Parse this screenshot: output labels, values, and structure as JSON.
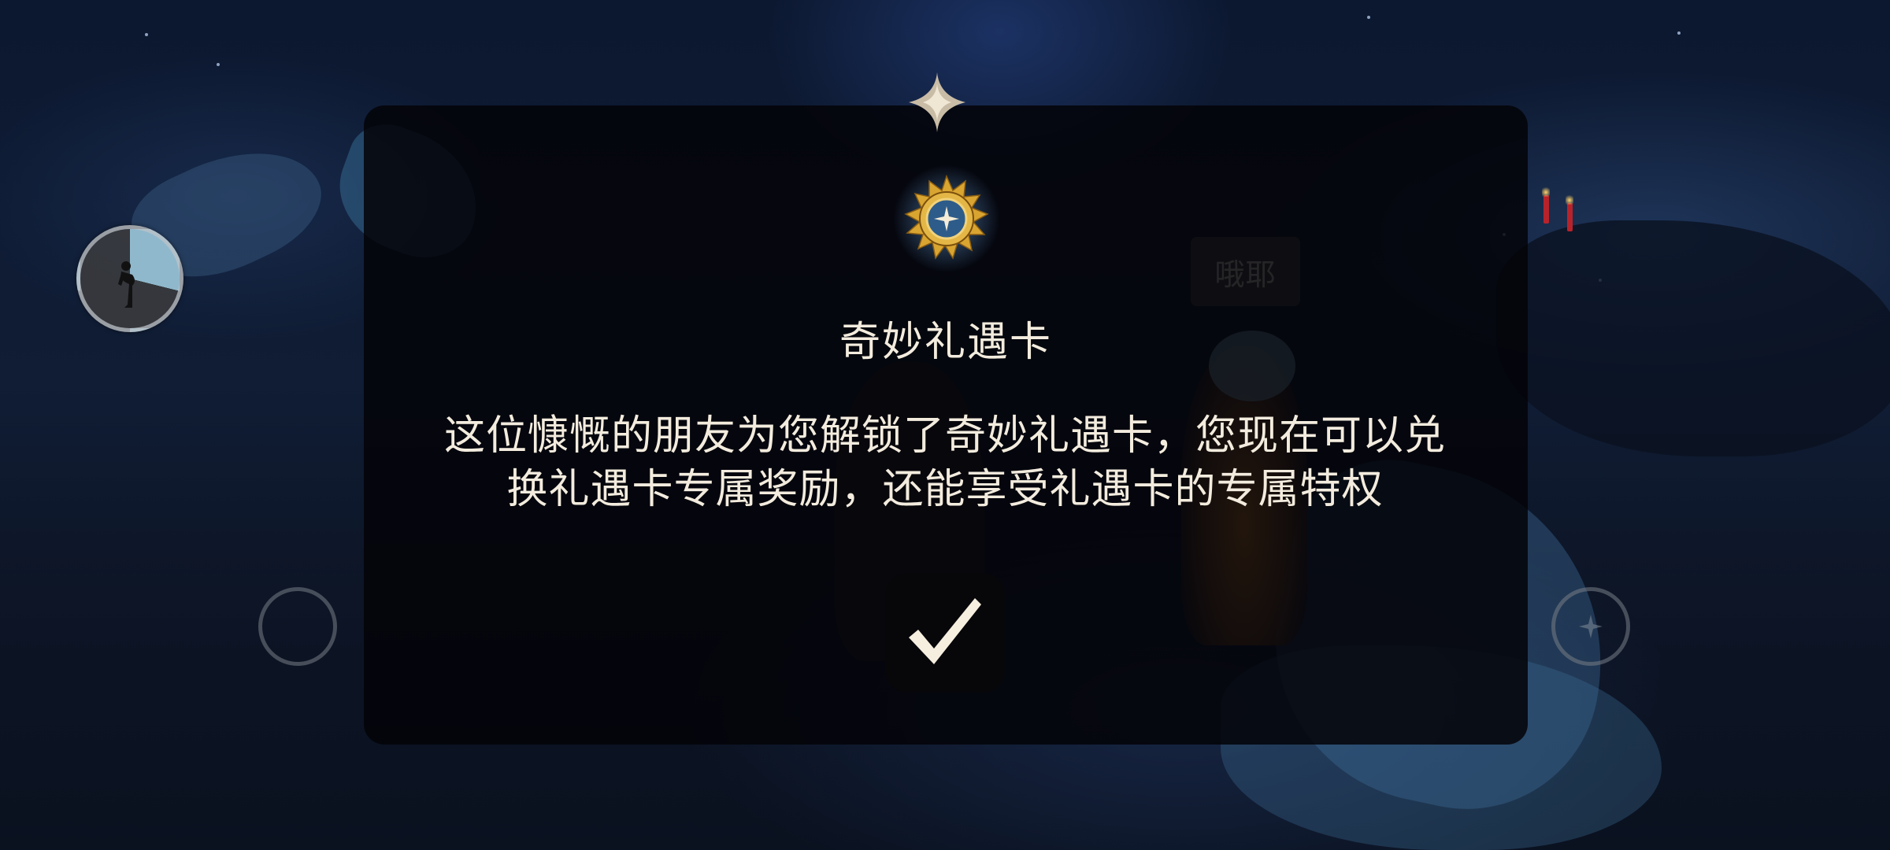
{
  "speech_bubble": {
    "text": "哦耶"
  },
  "dialog": {
    "title": "奇妙礼遇卡",
    "message_lines": [
      "这位慷慨的朋友为您解锁了奇妙礼遇卡，您现在可以兑",
      "换礼遇卡专属奖励，还能享受礼遇卡的专属特权"
    ],
    "icons": {
      "sparkle": "four-point-sparkle",
      "emblem": "golden-sun-card-emblem",
      "confirm": "checkmark"
    }
  },
  "hud": {
    "emote_button": {
      "icon": "bowing-figure",
      "charge_fraction": 0.29
    },
    "left_action_button": {
      "icon": "empty-ring"
    },
    "right_action_button": {
      "icon": "star-ring"
    }
  },
  "colors": {
    "text": "#f3ecde",
    "emblem_gold": "#d9a531",
    "emote_charge": "#8fb8cc",
    "dialog_bg": "rgba(3,4,8,0.86)"
  }
}
